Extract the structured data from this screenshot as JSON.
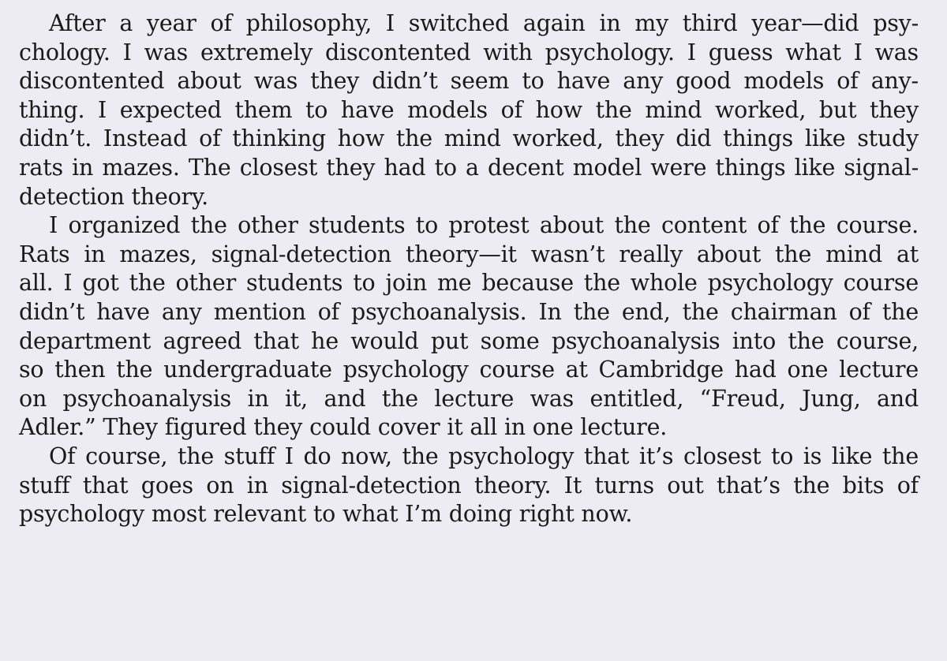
{
  "paragraphs": [
    {
      "lines": [
        "After a year of philosophy, I switched again in my third year—did psy-",
        "chology. I was extremely discontented with psychology. I guess what I was",
        "discontented about was they didn’t seem to have any good models of any-",
        "thing. I expected them to have models of how the mind worked, but they",
        "didn’t. Instead of thinking how the mind worked, they did things like study",
        "rats in mazes. The closest they had to a decent model were things like signal-",
        "detection theory."
      ]
    },
    {
      "lines": [
        "I organized the other students to protest about the content of the course.",
        "Rats in mazes, signal-detection theory—it wasn’t really about the mind at",
        "all. I got the other students to join me because the whole psychology course",
        "didn’t have any mention of psychoanalysis. In the end, the chairman of the",
        "department agreed that he would put some psychoanalysis into the course,",
        "so then the undergraduate psychology course at Cambridge had one lecture",
        "on psychoanalysis in it, and the lecture was entitled, “Freud, Jung, and",
        "Adler.” They figured they could cover it all in one lecture."
      ]
    },
    {
      "lines": [
        "Of course, the stuff I do now, the psychology that it’s closest to is like the",
        "stuff that goes on in signal-detection theory. It turns out that’s the bits of",
        "psychology most relevant to what I’m doing right now."
      ]
    }
  ]
}
